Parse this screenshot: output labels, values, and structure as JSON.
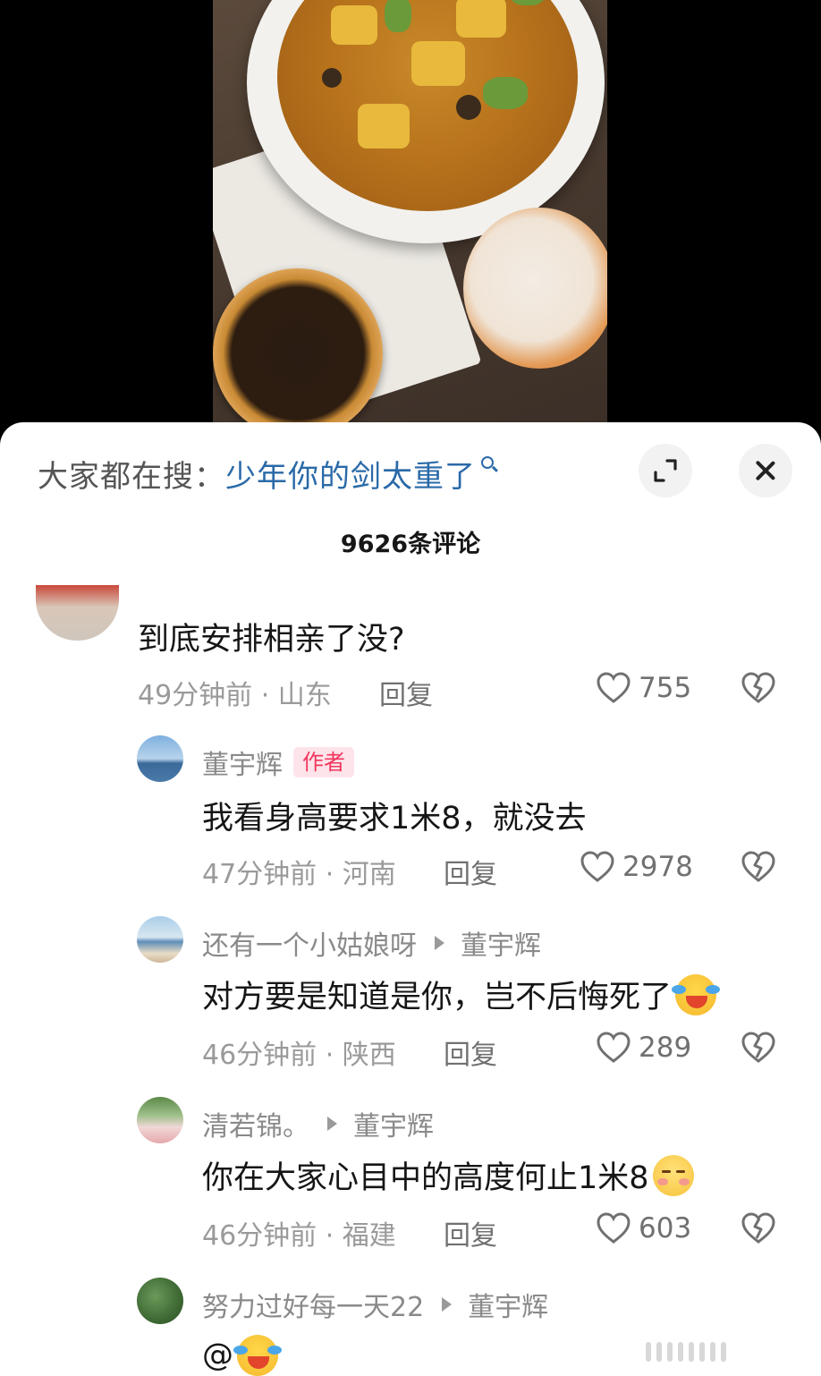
{
  "search": {
    "prefix": "大家都在搜：",
    "term": "少年你的剑太重了"
  },
  "header": {
    "comment_count": "9626条评论"
  },
  "comments": [
    {
      "username": "",
      "text": "到底安排相亲了没?",
      "meta": "49分钟前 · 山东",
      "reply_label": "回复",
      "likes": "755"
    },
    {
      "username": "董宇辉",
      "badge": "作者",
      "text": "我看身高要求1米8，就没去",
      "meta": "47分钟前 · 河南",
      "reply_label": "回复",
      "likes": "2978"
    },
    {
      "username": "还有一个小姑娘呀",
      "reply_to": "董宇辉",
      "text": "对方要是知道是你，岂不后悔死了",
      "emoji": "laughing-crying-emoji",
      "meta": "46分钟前 · 陕西",
      "reply_label": "回复",
      "likes": "289"
    },
    {
      "username": "清若锦。",
      "reply_to": "董宇辉",
      "text": "你在大家心目中的高度何止1米8",
      "emoji": "blushing-emoji",
      "meta": "46分钟前 · 福建",
      "reply_label": "回复",
      "likes": "603"
    },
    {
      "username": "努力过好每一天22",
      "reply_to": "董宇辉",
      "text": "@",
      "emoji": "laughing-crying-emoji"
    }
  ],
  "colors": {
    "search_term": "#2a6aa8",
    "author_badge_bg": "#fde4ea",
    "author_badge_text": "#f2365e",
    "meta_gray": "#9a9a9a"
  }
}
